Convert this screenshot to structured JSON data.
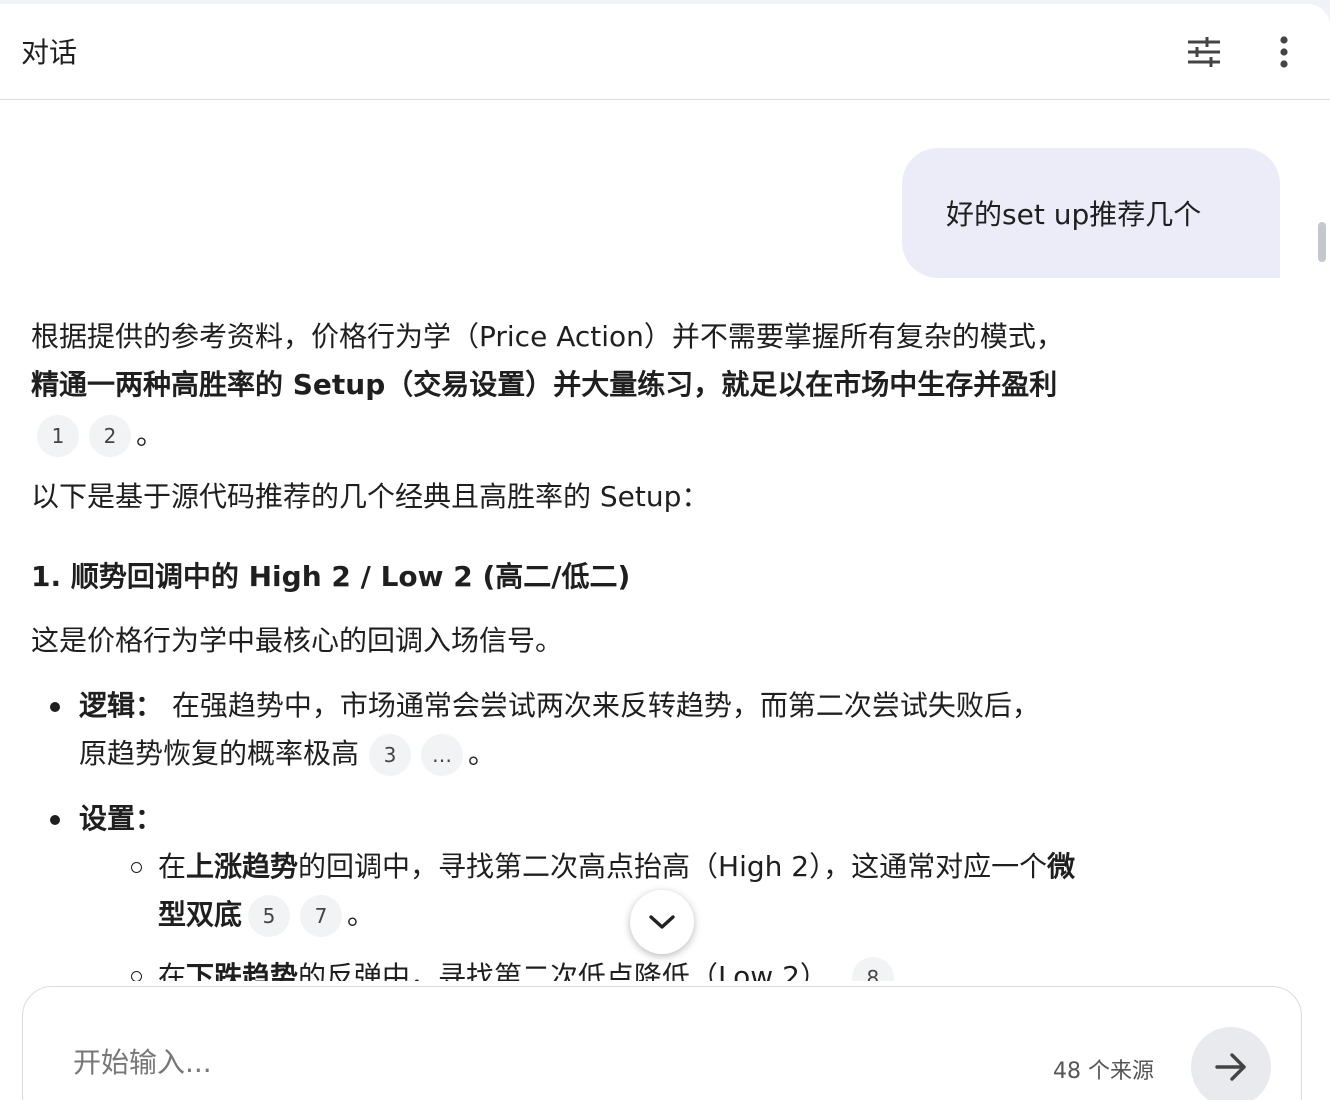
{
  "header": {
    "title": "对话",
    "settings_icon": "tune-icon",
    "more_icon": "more-vert-icon"
  },
  "user_message": "好的set up推荐几个",
  "answer": {
    "intro_1": "根据提供的参考资料，价格行为学（Price Action）并不需要掌握所有复杂的模式，",
    "intro_2_bold": "精通一两种高胜率的 Setup（交易设置）并大量练习，就足以在市场中生存并盈利",
    "intro_cites": [
      "1",
      "2"
    ],
    "period": "。",
    "intro_3": "以下是基于源代码推荐的几个经典且高胜率的 Setup：",
    "section1_title": "1. 顺势回调中的 High 2 / Low 2 (高二/低二)",
    "section1_desc": "这是价格行为学中最核心的回调入场信号。",
    "logic_label": "逻辑：",
    "logic_text_1": " 在强趋势中，市场通常会尝试两次来反转趋势，而第二次尝试失败后，",
    "logic_text_2": "原趋势恢复的概率极高",
    "logic_cites": [
      "3",
      "…"
    ],
    "setup_label": "设置：",
    "sub1_a": "在",
    "sub1_b_bold": "上涨趋势",
    "sub1_c": "的回调中，寻找第二次高点抬高（High 2），这通常对应一个",
    "sub1_d_bold": "微",
    "sub1_e_bold": "型双底",
    "sub1_cites": [
      "5",
      "7"
    ],
    "sub2_a": "在",
    "sub2_b_bold": "下跌趋势",
    "sub2_c": "的反弹中，寻找第二次低点降低（Low 2）",
    "sub2_cites": [
      "8"
    ]
  },
  "scroll_icon": "chevron-down-icon",
  "input": {
    "placeholder": "开始输入...",
    "sources_count": "48 个来源",
    "send_icon": "arrow-right-icon"
  }
}
